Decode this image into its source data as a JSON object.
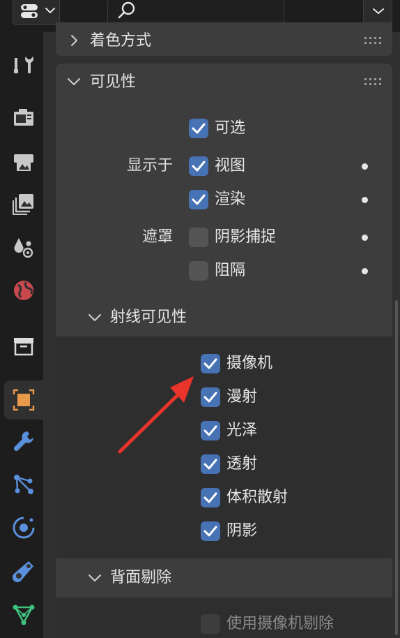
{
  "sections": {
    "shading": {
      "title": "着色方式"
    },
    "visibility": {
      "title": "可见性",
      "selectable": {
        "label": "可选",
        "checked": true
      },
      "show_in": {
        "label": "显示于"
      },
      "viewport": {
        "label": "视图",
        "checked": true
      },
      "render": {
        "label": "渲染",
        "checked": true
      },
      "mask": {
        "label": "遮罩"
      },
      "shadow_catcher": {
        "label": "阴影捕捉",
        "checked": false
      },
      "holdout": {
        "label": "阻隔",
        "checked": false
      }
    },
    "ray_visibility": {
      "title": "射线可见性",
      "items": [
        {
          "label": "摄像机",
          "checked": true
        },
        {
          "label": "漫射",
          "checked": true
        },
        {
          "label": "光泽",
          "checked": true
        },
        {
          "label": "透射",
          "checked": true
        },
        {
          "label": "体积散射",
          "checked": true
        },
        {
          "label": "阴影",
          "checked": true
        }
      ]
    },
    "backface_culling": {
      "title": "背面剔除",
      "use_camera_culling": {
        "label": "使用摄像机剔除",
        "checked": false,
        "enabled": false
      }
    }
  },
  "tabs": [
    "tool",
    "render",
    "output",
    "view-layer",
    "scene",
    "world",
    "collection",
    "object",
    "modifiers",
    "particles",
    "physics",
    "constraints",
    "data"
  ],
  "active_tab": "object",
  "colors": {
    "accent": "#4772b3",
    "annotation_arrow": "#e8342a",
    "active_tab_icon": "#e89a4a"
  }
}
